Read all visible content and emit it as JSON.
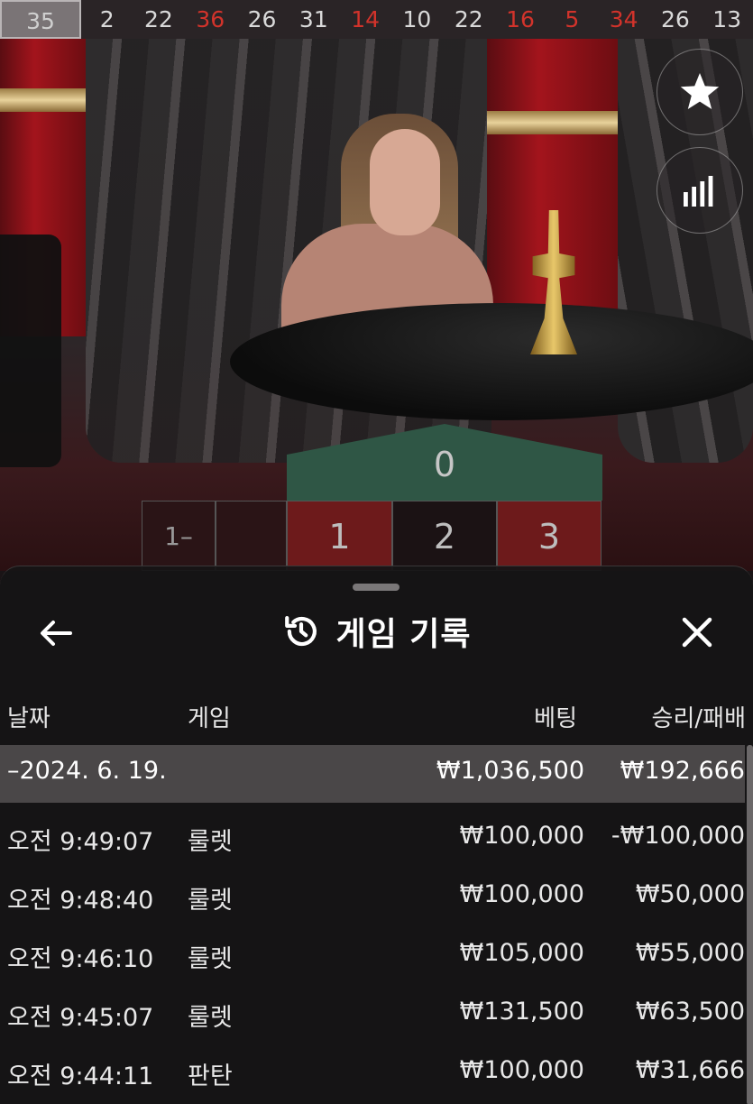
{
  "results_bar": {
    "current": "35",
    "items": [
      {
        "value": "2",
        "color": "white"
      },
      {
        "value": "22",
        "color": "white"
      },
      {
        "value": "36",
        "color": "red"
      },
      {
        "value": "26",
        "color": "white"
      },
      {
        "value": "31",
        "color": "white"
      },
      {
        "value": "14",
        "color": "red"
      },
      {
        "value": "10",
        "color": "white"
      },
      {
        "value": "22",
        "color": "white"
      },
      {
        "value": "16",
        "color": "red"
      },
      {
        "value": "5",
        "color": "red"
      },
      {
        "value": "34",
        "color": "red"
      },
      {
        "value": "26",
        "color": "white"
      },
      {
        "value": "13",
        "color": "white"
      }
    ]
  },
  "side_buttons": {
    "favorite_icon": "star-icon",
    "stats_icon": "bar-chart-icon"
  },
  "table": {
    "zero": "0",
    "n1": "1",
    "n2": "2",
    "n3": "3",
    "side_label": "1–"
  },
  "history": {
    "title": "게임 기록",
    "back_icon": "arrow-left-icon",
    "close_icon": "close-icon",
    "columns": {
      "date": "날짜",
      "game": "게임",
      "bet": "베팅",
      "result": "승리/패배"
    },
    "date_group": {
      "date": "–2024. 6. 19.",
      "bet": "₩1,036,500",
      "result": "₩192,666"
    },
    "rows": [
      {
        "time": "오전 9:49:07",
        "game": "룰렛",
        "bet": "₩100,000",
        "result": "-₩100,000"
      },
      {
        "time": "오전 9:48:40",
        "game": "룰렛",
        "bet": "₩100,000",
        "result": "₩50,000"
      },
      {
        "time": "오전 9:46:10",
        "game": "룰렛",
        "bet": "₩105,000",
        "result": "₩55,000"
      },
      {
        "time": "오전 9:45:07",
        "game": "룰렛",
        "bet": "₩131,500",
        "result": "₩63,500"
      },
      {
        "time": "오전 9:44:11",
        "game": "판탄",
        "bet": "₩100,000",
        "result": "₩31,666"
      }
    ]
  },
  "colors": {
    "red_number": "#d2332b",
    "zero_green": "#2f5645",
    "red_cell": "#6d1a1b"
  }
}
